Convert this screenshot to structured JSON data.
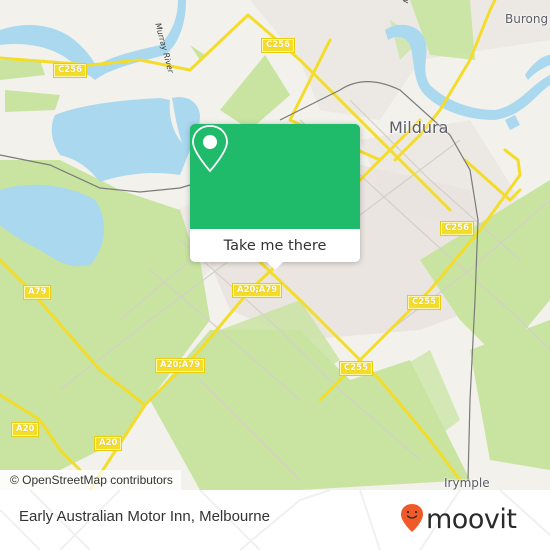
{
  "map": {
    "colors": {
      "land": "#f2f1ec",
      "water": "#aad8ef",
      "green": "#c8e4a0",
      "urban": "#e8e2de",
      "road_major": "#f4dc2a",
      "road_minor": "#d3d0c8",
      "railway": "#7a7a7a"
    },
    "places": {
      "city": "Mildura",
      "north_east": "Burong",
      "south_east": "Irymple"
    },
    "river_label": "Murray River",
    "road_shields": {
      "c256_west": "C256",
      "c256_north": "C256",
      "c256_east": "C256",
      "a79_west": "A79",
      "a20_a79_center": "A20;A79",
      "a20_a79_southwest": "A20;A79",
      "c255_east": "C255",
      "c255_south": "C255",
      "a20_west": "A20",
      "a20_south": "A20"
    },
    "attribution": "© OpenStreetMap contributors"
  },
  "popup": {
    "icon": "location-pin-icon",
    "action_label": "Take me there",
    "accent_color": "#1fba6a"
  },
  "footer": {
    "place_name": "Early Australian Motor Inn, Melbourne",
    "logo": {
      "icon": "moovit-pin-icon",
      "word": "moovit",
      "accent_color": "#f05a28"
    }
  }
}
